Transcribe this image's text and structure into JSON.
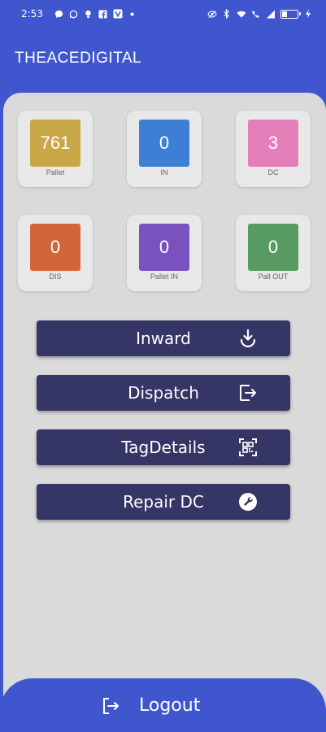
{
  "status_bar": {
    "time": "2:53",
    "icons_left": [
      "message-icon",
      "whatsapp-icon",
      "bulb-icon",
      "facebook-icon",
      "v-app-icon",
      "dot-icon"
    ],
    "icons_right": [
      "eye-off-icon",
      "bluetooth-icon",
      "wifi-icon",
      "volte-call-icon",
      "signal-icon",
      "battery-icon"
    ]
  },
  "app_bar": {
    "title": "THEACEDIGITAL"
  },
  "tiles": [
    {
      "value": "761",
      "label": "Pallet",
      "color": "#c9a646"
    },
    {
      "value": "0",
      "label": "IN",
      "color": "#3d7fd4"
    },
    {
      "value": "3",
      "label": "DC",
      "color": "#e57fb9"
    },
    {
      "value": "0",
      "label": "DIS",
      "color": "#d2663a"
    },
    {
      "value": "0",
      "label": "Pallet IN",
      "color": "#7a52bd"
    },
    {
      "value": "0",
      "label": "Pall OUT",
      "color": "#579a62"
    }
  ],
  "buttons": {
    "inward": {
      "label": "Inward",
      "icon": "download-icon"
    },
    "dispatch": {
      "label": "Dispatch",
      "icon": "exit-icon"
    },
    "tag_details": {
      "label": "TagDetails",
      "icon": "qr-code-icon"
    },
    "repair_dc": {
      "label": "Repair DC",
      "icon": "wrench-icon"
    }
  },
  "logout": {
    "label": "Logout",
    "icon": "logout-icon"
  },
  "colors": {
    "primary": "#3f56cf",
    "button": "#353566",
    "content_bg": "#dadada",
    "tile_bg": "#e8e8e8"
  }
}
